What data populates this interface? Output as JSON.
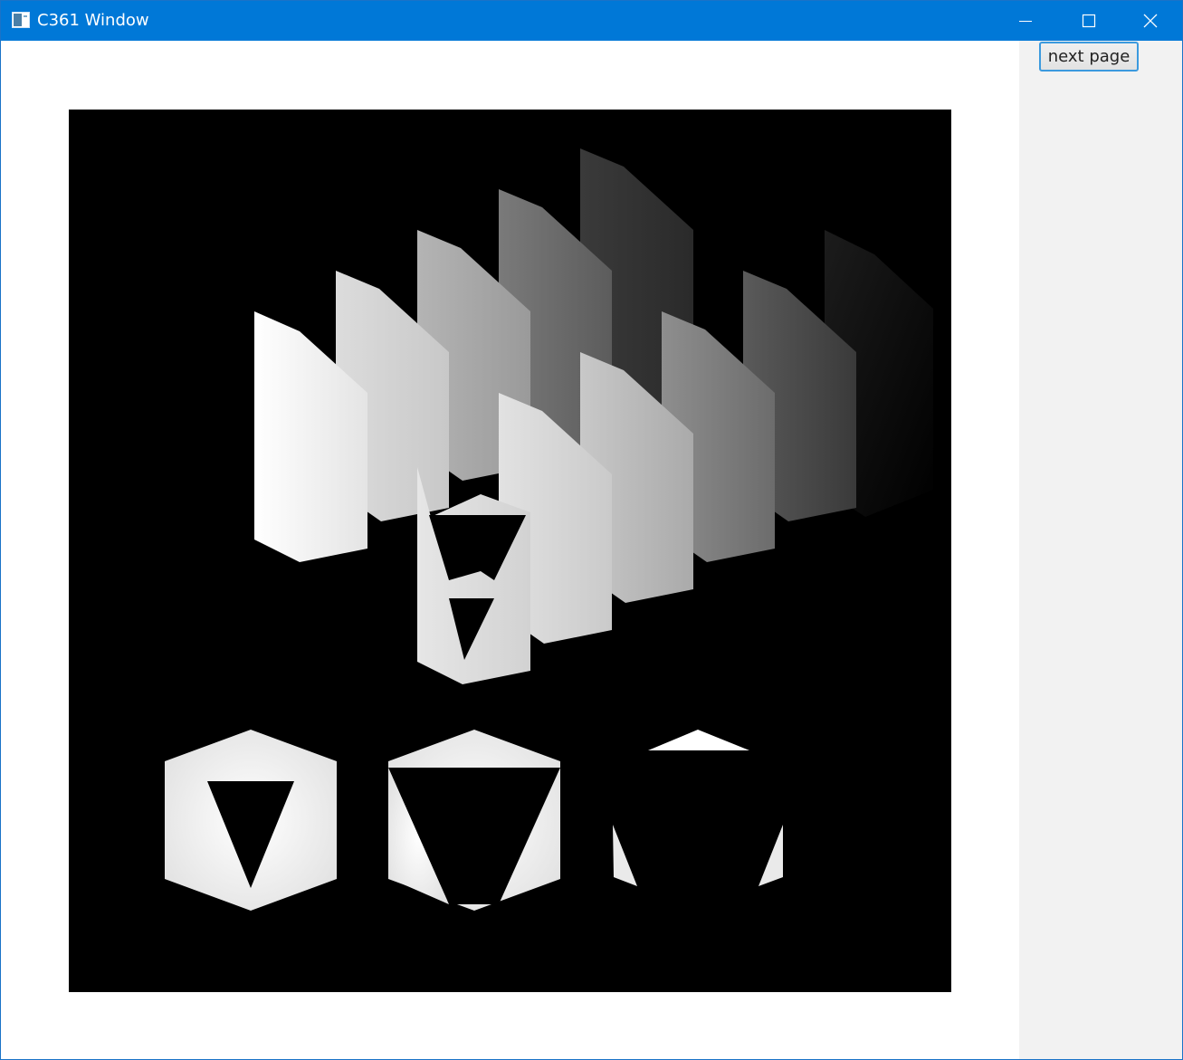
{
  "window": {
    "title": "C361 Window",
    "controls": {
      "minimize_icon": "minimize-icon",
      "maximize_icon": "maximize-icon",
      "close_icon": "close-icon"
    },
    "colors": {
      "titlebar": "#0078d7",
      "title_text": "#ffffff",
      "side_panel": "#f2f2f2",
      "canvas_background": "#000000"
    }
  },
  "side_panel": {
    "next_button_label": "next page"
  },
  "scene": {
    "description_icon": "rendered-3d-prisms-canvas"
  }
}
